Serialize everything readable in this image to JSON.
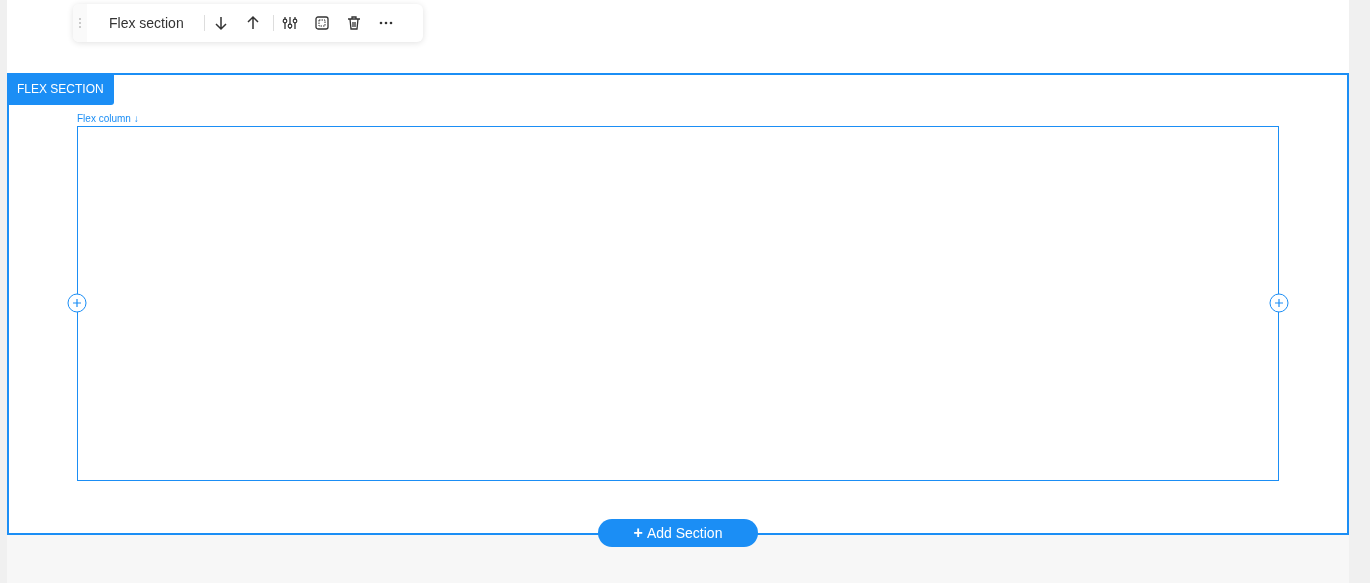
{
  "toolbar": {
    "title": "Flex section",
    "actions": [
      {
        "kind": "move-down"
      },
      {
        "kind": "move-up"
      },
      {
        "kind": "settings"
      },
      {
        "kind": "select"
      },
      {
        "kind": "delete"
      },
      {
        "kind": "more"
      }
    ]
  },
  "section": {
    "label": "FLEX SECTION",
    "column": {
      "label": "Flex column ↓"
    }
  },
  "add_section": {
    "icon": "+",
    "label": "Add Section"
  }
}
